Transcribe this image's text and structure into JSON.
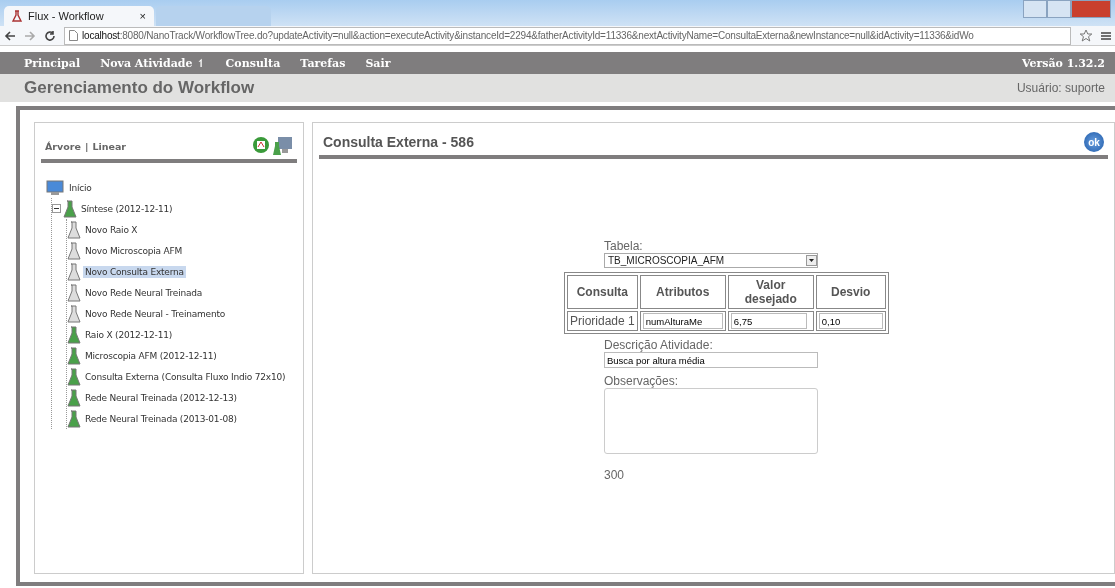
{
  "browser": {
    "tabs": [
      {
        "title": "Flux - Workflow",
        "selected": true,
        "close": "×"
      },
      {
        "selected": false
      }
    ],
    "url_host": "localhost",
    "url_rest": ":8080/NanoTrack/WorkflowTree.do?updateActivity=null&action=executeActivity&instanceId=2294&fatherActivityId=11336&nextActivityName=ConsultaExterna&newInstance=null&idActivity=11336&idWo"
  },
  "menu": {
    "items": [
      "Principal",
      "Nova Atividade ↿",
      "Consulta",
      "Tarefas",
      "Sair"
    ],
    "version": "Versão 1.32.2"
  },
  "header": {
    "title": "Gerenciamento do Workflow",
    "user": "Usuário: suporte"
  },
  "sidebar": {
    "view_links": [
      "Árvore",
      "Linear"
    ],
    "separator": "|",
    "tree": [
      {
        "label": "Início",
        "kind": "computer",
        "selected": false,
        "children": [
          {
            "label": "Síntese (2012-12-11)",
            "kind": "flask",
            "completed": true,
            "expanded": true,
            "selected": false,
            "children": [
              {
                "label": "Novo Raio X",
                "kind": "flask",
                "completed": false,
                "selected": false
              },
              {
                "label": "Novo Microscopia AFM",
                "kind": "flask",
                "completed": false,
                "selected": false
              },
              {
                "label": "Novo Consulta Externa",
                "kind": "flask",
                "completed": false,
                "selected": true
              },
              {
                "label": "Novo Rede Neural Treinada",
                "kind": "flask",
                "completed": false,
                "selected": false
              },
              {
                "label": "Novo Rede Neural - Treinamento",
                "kind": "flask",
                "completed": false,
                "selected": false
              },
              {
                "label": "Raio X (2012-12-11)",
                "kind": "flask",
                "completed": true,
                "selected": false
              },
              {
                "label": "Microscopia AFM (2012-12-11)",
                "kind": "flask",
                "completed": true,
                "selected": false
              },
              {
                "label": "Consulta Externa (Consulta Fluxo Indio 72x10)",
                "kind": "flask",
                "completed": true,
                "selected": false
              },
              {
                "label": "Rede Neural Treinada (2012-12-13)",
                "kind": "flask",
                "completed": true,
                "selected": false
              },
              {
                "label": "Rede Neural Treinada (2013-01-08)",
                "kind": "flask",
                "completed": true,
                "selected": false
              }
            ]
          }
        ]
      }
    ]
  },
  "main": {
    "title": "Consulta Externa - 586",
    "ok_label": "ok",
    "form": {
      "table_label": "Tabela:",
      "table_value": "TB_MICROSCOPIA_AFM",
      "columns": [
        "Consulta",
        "Atributos",
        "Valor desejado",
        "Desvio"
      ],
      "rows": [
        {
          "consulta": "Prioridade 1",
          "atributo": "numAlturaMe",
          "valor": "6,75",
          "desvio": "0,10"
        }
      ],
      "description_label": "Descrição Atividade:",
      "description": "Busca por altura média",
      "notes_label": "Observações:",
      "count": "300"
    }
  }
}
